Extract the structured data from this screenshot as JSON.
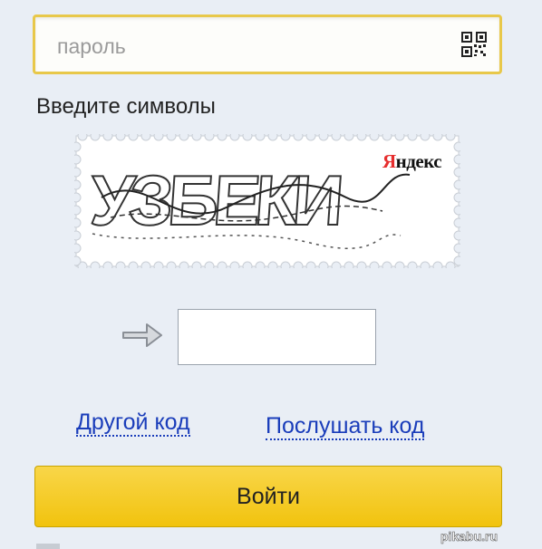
{
  "password": {
    "placeholder": "пароль",
    "icon": "qr-code-icon"
  },
  "captcha": {
    "label": "Введите символы",
    "image_text": "УЗБЕКИ",
    "brand_first": "Я",
    "brand_rest": "ндекс",
    "input_value": "",
    "arrow_icon": "arrow-right-icon"
  },
  "links": {
    "other_code": "Другой код",
    "listen_code": "Послушать код"
  },
  "login_button": "Войти",
  "watermark": "pikabu.ru",
  "colors": {
    "accent_yellow": "#f5cb1f",
    "link_blue": "#1a3dba",
    "background": "#e9eef5"
  }
}
